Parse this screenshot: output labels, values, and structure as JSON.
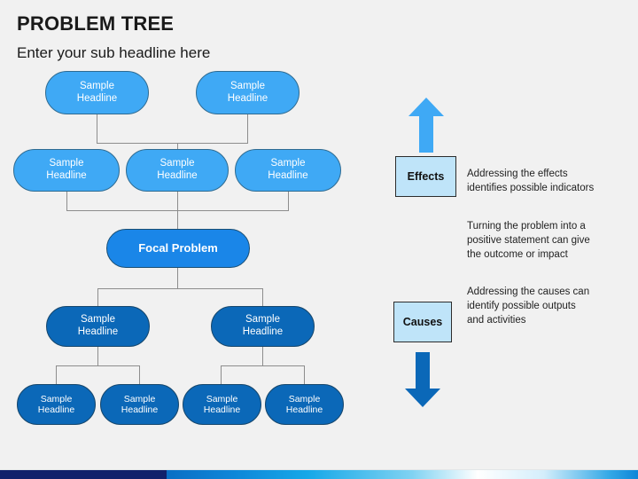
{
  "slide": {
    "title": "PROBLEM TREE",
    "subtitle": "Enter your sub headline here",
    "background_color": "#f1f1f1"
  },
  "colors": {
    "effect_node": "#3fa9f5",
    "focal_node": "#1a86e8",
    "cause_node": "#0b68b8",
    "legend_box": "#bfe4f9",
    "up_arrow": "#3fa9f5",
    "down_arrow": "#0b68b8",
    "connector_line": "#8d8d8d",
    "footer_navy": "#11216b"
  },
  "tree": {
    "effects_row_1": [
      {
        "label": "Sample\nHeadline"
      },
      {
        "label": "Sample\nHeadline"
      }
    ],
    "effects_row_2": [
      {
        "label": "Sample\nHeadline"
      },
      {
        "label": "Sample\nHeadline"
      },
      {
        "label": "Sample\nHeadline"
      }
    ],
    "focal": {
      "label": "Focal Problem"
    },
    "causes_row_1": [
      {
        "label": "Sample\nHeadline"
      },
      {
        "label": "Sample\nHeadline"
      }
    ],
    "causes_row_2": [
      {
        "label": "Sample\nHeadline"
      },
      {
        "label": "Sample\nHeadline"
      },
      {
        "label": "Sample\nHeadline"
      },
      {
        "label": "Sample\nHeadline"
      }
    ]
  },
  "legend": {
    "effects_label": "Effects",
    "causes_label": "Causes",
    "effects_description": "Addressing the effects\nidentifies possible indicators",
    "middle_description": "Turning the problem into a\npositive statement can give\nthe outcome or impact",
    "causes_description": "Addressing the causes can\nidentify possible outputs\nand activities",
    "up_arrow_icon": "up-arrow-icon",
    "down_arrow_icon": "down-arrow-icon"
  }
}
